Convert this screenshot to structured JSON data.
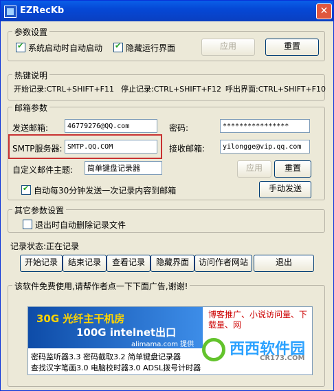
{
  "window": {
    "title": "EZRecKb",
    "close_glyph": "✕"
  },
  "params": {
    "title": "参数设置",
    "auto_start": {
      "label": "系统启动时自动启动",
      "checked": true
    },
    "hide_ui": {
      "label": "隐藏运行界面",
      "checked": true
    },
    "apply": "应用",
    "reset": "重置"
  },
  "hotkeys": {
    "title": "热键说明",
    "start": "开始记录:CTRL+SHIFT+F11",
    "stop": "停止记录:CTRL+SHIFT+F12",
    "show": "呼出界面:CTRL+SHIFT+F10"
  },
  "mail": {
    "title": "邮箱参数",
    "send_label": "发送邮箱:",
    "send_value": "46779276@QQ.com",
    "pwd_label": "密码:",
    "pwd_value": "****************",
    "smtp_label": "SMTP服务器:",
    "smtp_value": "SMTP.QQ.COM",
    "recv_label": "接收邮箱:",
    "recv_value": "yilongge@vip.qq.com",
    "subject_label": "自定义邮件主题:",
    "subject_value": "简单键盘记录器",
    "apply": "应用",
    "reset": "重置",
    "auto_send": {
      "label": "自动每30分钟发送一次记录内容到邮箱",
      "checked": true
    },
    "manual_send": "手动发送"
  },
  "other": {
    "title": "其它参数设置",
    "auto_delete": {
      "label": "退出时自动删除记录文件",
      "checked": false
    }
  },
  "status": {
    "label": "记录状态:正在记录"
  },
  "actions": [
    "开始记录",
    "结束记录",
    "查看记录",
    "隐藏界面",
    "访问作者网站",
    "退出"
  ],
  "ad": {
    "title": "该软件免费使用,请帮作者点一下下面广告,谢谢!",
    "banner_line1": "30G 光纤主干机房",
    "banner_line2": "100G intelnet出口",
    "banner_brand": "alimama.com 提供",
    "side_text": "博客推广、小说访问量、下载量、网",
    "line1": "密码监听器3.3 密码截取3.2 简单键盘记录器",
    "line2": "查找汉字笔画3.0 电脑校时器3.0 ADSL拨号计时器"
  },
  "watermark": {
    "text": "西西软件园",
    "sub": "CR173.COM"
  }
}
